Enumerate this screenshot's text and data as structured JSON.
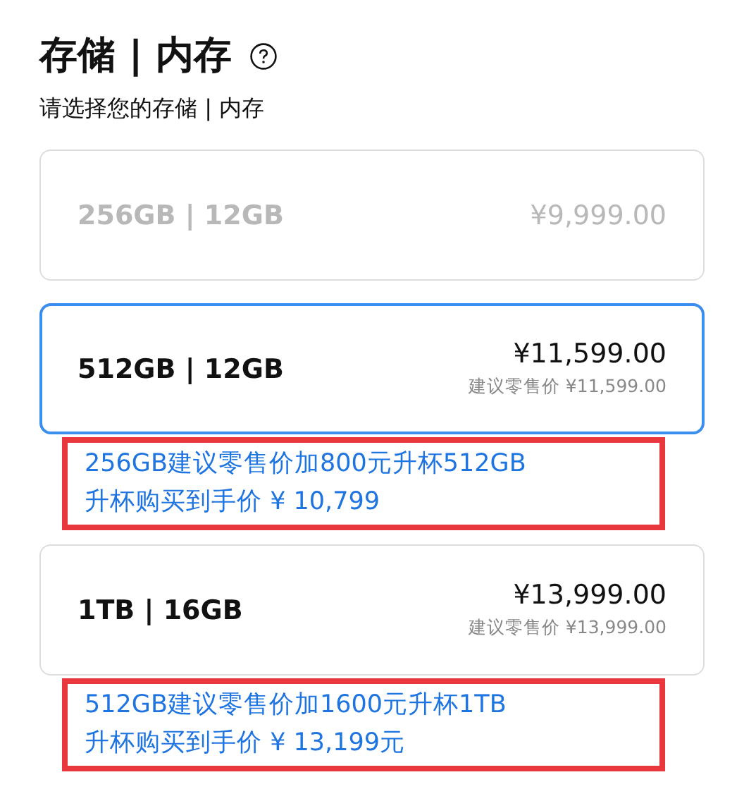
{
  "header": {
    "title": "存储 | 内存",
    "subtitle": "请选择您的存储 | 内存"
  },
  "options": [
    {
      "label": "256GB | 12GB",
      "price": "¥9,999.00",
      "disabled": true,
      "selected": false
    },
    {
      "label": "512GB | 12GB",
      "price": "¥11,599.00",
      "retail_note": "建议零售价 ¥11,599.00",
      "disabled": false,
      "selected": true,
      "promo": [
        "256GB建议零售价加800元升杯512GB",
        "升杯购买到手价 ¥ 10,799"
      ]
    },
    {
      "label": "1TB | 16GB",
      "price": "¥13,999.00",
      "retail_note": "建议零售价 ¥13,999.00",
      "disabled": false,
      "selected": false,
      "promo": [
        "512GB建议零售价加1600元升杯1TB",
        "升杯购买到手价 ¥ 13,199元"
      ]
    }
  ]
}
